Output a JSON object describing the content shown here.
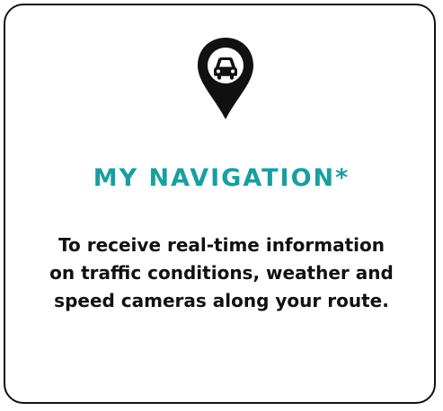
{
  "card": {
    "icon": "location-pin-car-icon",
    "title": "MY NAVIGATION*",
    "description_lines": [
      "To receive real-time information",
      "on traffic conditions, weather and",
      "speed cameras along your route."
    ]
  },
  "colors": {
    "accent": "#1a9ea0",
    "text": "#111111",
    "border": "#111111",
    "background": "#ffffff"
  }
}
